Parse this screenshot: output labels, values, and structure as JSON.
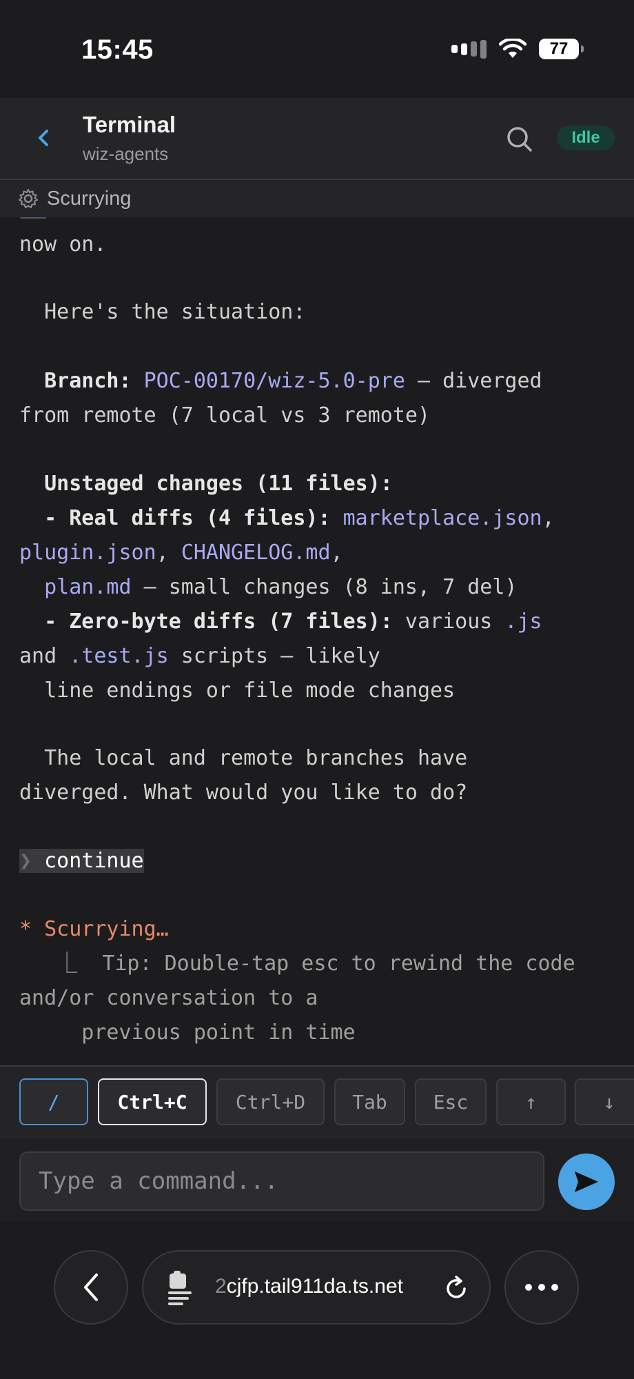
{
  "status_bar": {
    "time": "15:45",
    "battery": "77"
  },
  "header": {
    "title": "Terminal",
    "subtitle": "wiz-agents",
    "status_badge": "Idle"
  },
  "activity": {
    "label": "Scurrying"
  },
  "terminal": {
    "line_partial": "now on.",
    "situation": "  Here's the situation:",
    "branch_label": "  Branch: ",
    "branch_name": "POC-00170/wiz-5.0-pre",
    "branch_rest": " — diverged",
    "branch_line2": "from remote (7 local vs 3 remote)",
    "unstaged": "  Unstaged changes (11 files):",
    "real_diffs_label": "  - Real diffs (4 files): ",
    "file_marketplace": "marketplace.json",
    "comma": ",",
    "file_plugin": "plugin.json",
    "file_changelog": "CHANGELOG.md",
    "plan_indent": "  ",
    "file_plan": "plan.md",
    "plan_rest": " — small changes (8 ins, 7 del)",
    "zero_label": "  - Zero-byte diffs (7 files): ",
    "zero_various": "various ",
    "ext_js": ".js",
    "and": "and ",
    "ext_test_js": ".test.js",
    "scripts_rest": " scripts — likely",
    "line_endings": "  line endings or file mode changes",
    "diverged1": "  The local and remote branches have",
    "diverged2": "diverged. What would you like to do?",
    "prompt_chevron": "❯",
    "prompt_cmd": " continue",
    "spinner_star": "*",
    "spinner_text": " Scurrying…",
    "tip_corner": "   ⎿  ",
    "tip_line1": "Tip: Double-tap esc to rewind the code",
    "tip_line2": "and/or conversation to a",
    "tip_line3": "     previous point in time"
  },
  "keys": [
    "/",
    "Ctrl+C",
    "Ctrl+D",
    "Tab",
    "Esc",
    "↑",
    "↓"
  ],
  "command_input": {
    "placeholder": "Type a command..."
  },
  "browser": {
    "url_faded": "2",
    "url": "cjfp.tail911da.ts.net"
  }
}
